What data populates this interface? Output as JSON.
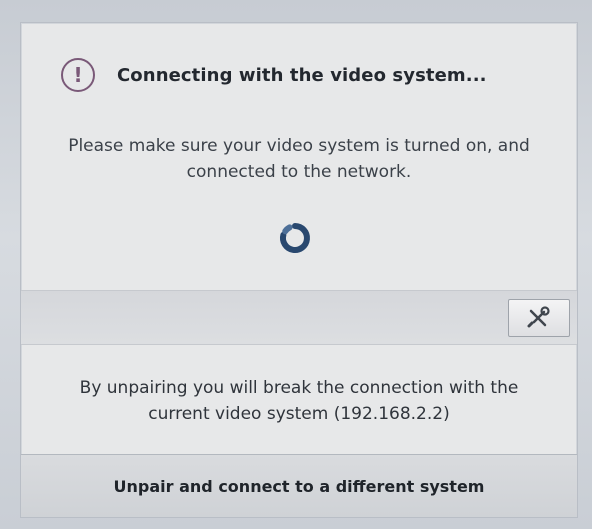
{
  "dialog": {
    "title": "Connecting with the video system...",
    "message_line1": "Please make sure your video system is turned on, and",
    "message_line2": "connected to the network.",
    "unpair_note_line1": "By unpairing you will break the connection with the",
    "unpair_note_line2": "current video system (192.168.2.2)",
    "unpair_button_label": "Unpair and connect to a different system",
    "alert_icon_glyph": "!"
  },
  "icons": {
    "alert": "exclamation-circle-icon",
    "spinner": "loading-spinner-icon",
    "tools": "wrench-screwdriver-icon"
  },
  "colors": {
    "alert_icon": "#7a5978",
    "spinner": "#29486f",
    "text": "#23282f"
  }
}
